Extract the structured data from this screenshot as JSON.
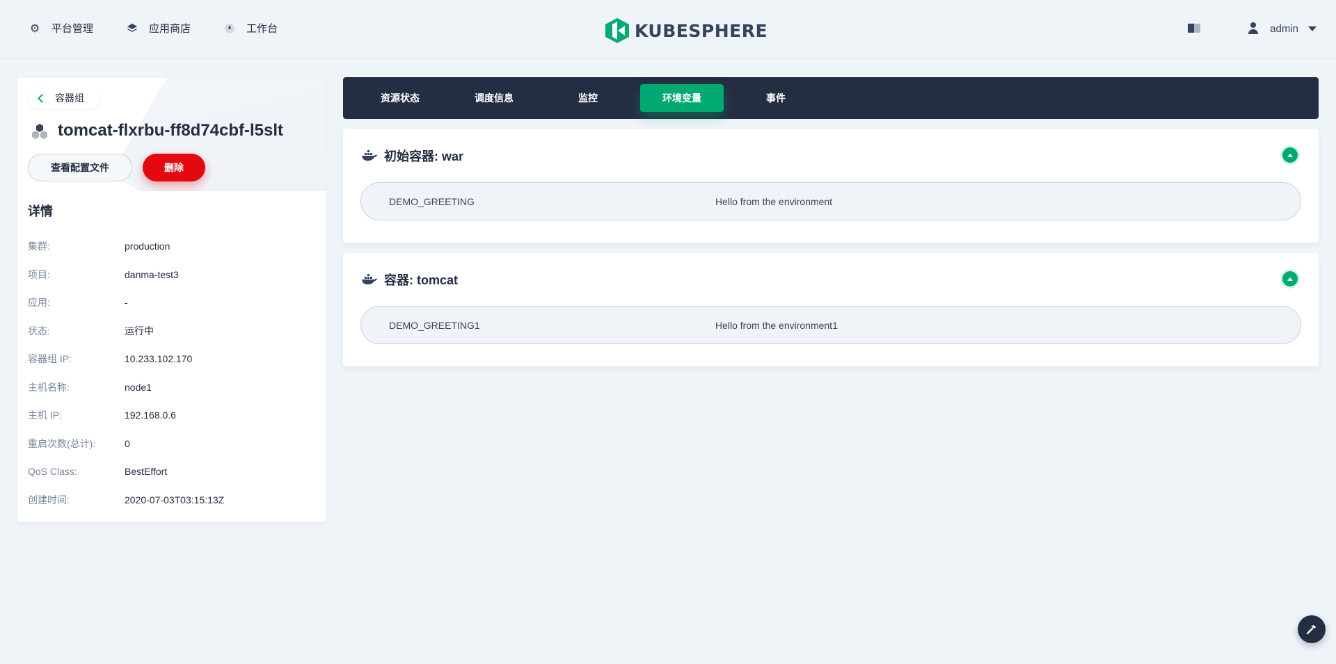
{
  "nav": {
    "items": [
      {
        "label": "平台管理",
        "icon": "gear-icon"
      },
      {
        "label": "应用商店",
        "icon": "layers-icon"
      },
      {
        "label": "工作台",
        "icon": "compass-icon"
      }
    ],
    "logo_text": "KUBESPHERE",
    "user": "admin"
  },
  "pod": {
    "back_label": "容器组",
    "name": "tomcat-flxrbu-ff8d74cbf-l5slt",
    "view_config_label": "查看配置文件",
    "delete_label": "删除"
  },
  "details": {
    "title": "详情",
    "rows": [
      {
        "key": "集群:",
        "value": "production"
      },
      {
        "key": "项目:",
        "value": "danma-test3"
      },
      {
        "key": "应用:",
        "value": "-"
      },
      {
        "key": "状态:",
        "value": "运行中"
      },
      {
        "key": "容器组 IP:",
        "value": "10.233.102.170"
      },
      {
        "key": "主机名称:",
        "value": "node1"
      },
      {
        "key": "主机 IP:",
        "value": "192.168.0.6"
      },
      {
        "key": "重启次数(总计):",
        "value": "0"
      },
      {
        "key": "QoS Class:",
        "value": "BestEffort"
      },
      {
        "key": "创建时间:",
        "value": "2020-07-03T03:15:13Z"
      }
    ]
  },
  "tabs": [
    {
      "label": "资源状态",
      "active": false
    },
    {
      "label": "调度信息",
      "active": false
    },
    {
      "label": "监控",
      "active": false
    },
    {
      "label": "环境变量",
      "active": true
    },
    {
      "label": "事件",
      "active": false
    }
  ],
  "containers": [
    {
      "title": "初始容器: war",
      "env": [
        {
          "name": "DEMO_GREETING",
          "value": "Hello from the environment"
        }
      ]
    },
    {
      "title": "容器: tomcat",
      "env": [
        {
          "name": "DEMO_GREETING1",
          "value": "Hello from the environment1"
        }
      ]
    }
  ],
  "colors": {
    "accent": "#00aa72",
    "danger": "#e4080f",
    "dark": "#242e42",
    "background": "#eff4f9"
  }
}
